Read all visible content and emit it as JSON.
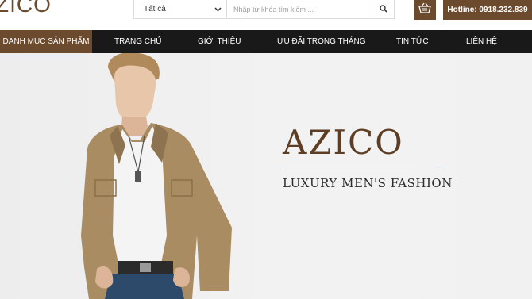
{
  "header": {
    "logo_text": "ZICO",
    "search": {
      "category_selected": "Tất cả",
      "placeholder": "Nhập từ khóa tìm kiếm ..."
    },
    "hotline": "Hotline: 0918.232.839"
  },
  "nav": {
    "category_menu": "DANH MỤC SẢN PHẨM",
    "items": [
      "TRANG CHỦ",
      "GIỚI THIỆU",
      "ƯU ĐÃI TRONG THÁNG",
      "TIN TỨC",
      "LIÊN HỆ"
    ]
  },
  "banner": {
    "brand": "AZICO",
    "tagline": "LUXURY MEN'S FASHION"
  },
  "colors": {
    "brand_brown": "#6b4a2e",
    "nav_bg": "#191919",
    "banner_bg": "#efefef"
  },
  "icons": {
    "search": "search-icon",
    "cart": "cart-icon",
    "category_dropdown": "chevron-down-icon"
  }
}
